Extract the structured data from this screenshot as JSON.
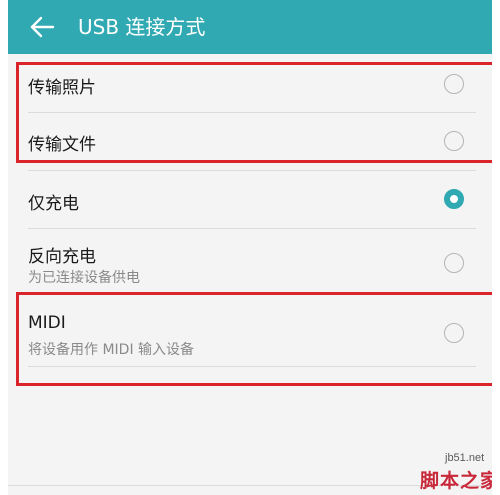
{
  "header": {
    "back_icon": "back-arrow-icon",
    "title": "USB 连接方式"
  },
  "options": [
    {
      "label": "传输照片",
      "subtitle": "",
      "selected": false
    },
    {
      "label": "传输文件",
      "subtitle": "",
      "selected": false
    },
    {
      "label": "仅充电",
      "subtitle": "",
      "selected": true
    },
    {
      "label": "反向充电",
      "subtitle": "为已连接设备供电",
      "selected": false
    },
    {
      "label": "MIDI",
      "subtitle": "将设备用作 MIDI 输入设备",
      "selected": false
    }
  ],
  "watermark": {
    "url": "jb51.net",
    "name": "脚本之家"
  },
  "colors": {
    "accent": "#30a9b3",
    "highlight_box": "#d9242b",
    "background": "#f4f4f4"
  }
}
